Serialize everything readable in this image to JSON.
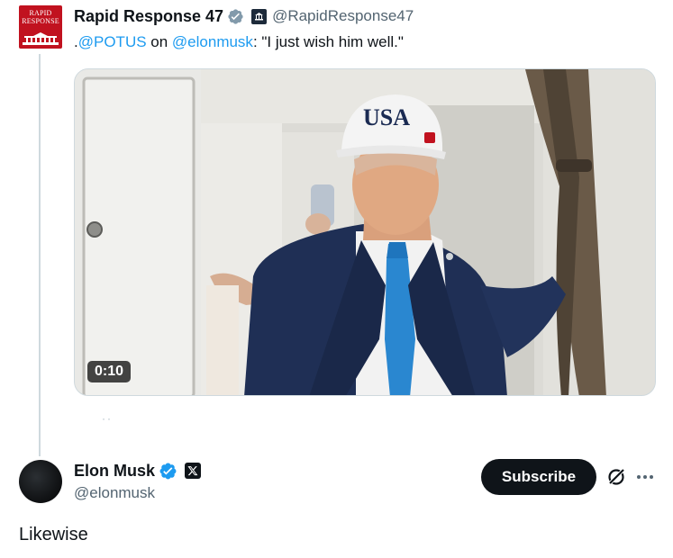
{
  "parent": {
    "avatar_logo_text": "RAPID RESPONSE",
    "name": "Rapid Response 47",
    "handle": "@RapidResponse47",
    "text_prefix": ".",
    "mention_1": "@POTUS",
    "text_mid": " on ",
    "mention_2": "@elonmusk",
    "text_suffix": ": \"I just wish him well.\"",
    "video": {
      "duration": "0:10",
      "cap_text": "USA"
    },
    "verified_badge_color": "#829aab",
    "affiliate_badge_icon": "white-house-icon"
  },
  "main": {
    "name": "Elon Musk",
    "handle": "@elonmusk",
    "text": "Likewise",
    "subscribe_label": "Subscribe",
    "verified_badge_color": "#1d9bf0",
    "affiliate_badge_icon": "x-logo-icon",
    "action_icons": [
      "grok-icon",
      "more-icon"
    ]
  },
  "colors": {
    "link": "#1d9bf0",
    "text": "#0f1419",
    "secondary": "#536471",
    "thread_line": "#cfd9de",
    "brand_red": "#c1121f"
  }
}
